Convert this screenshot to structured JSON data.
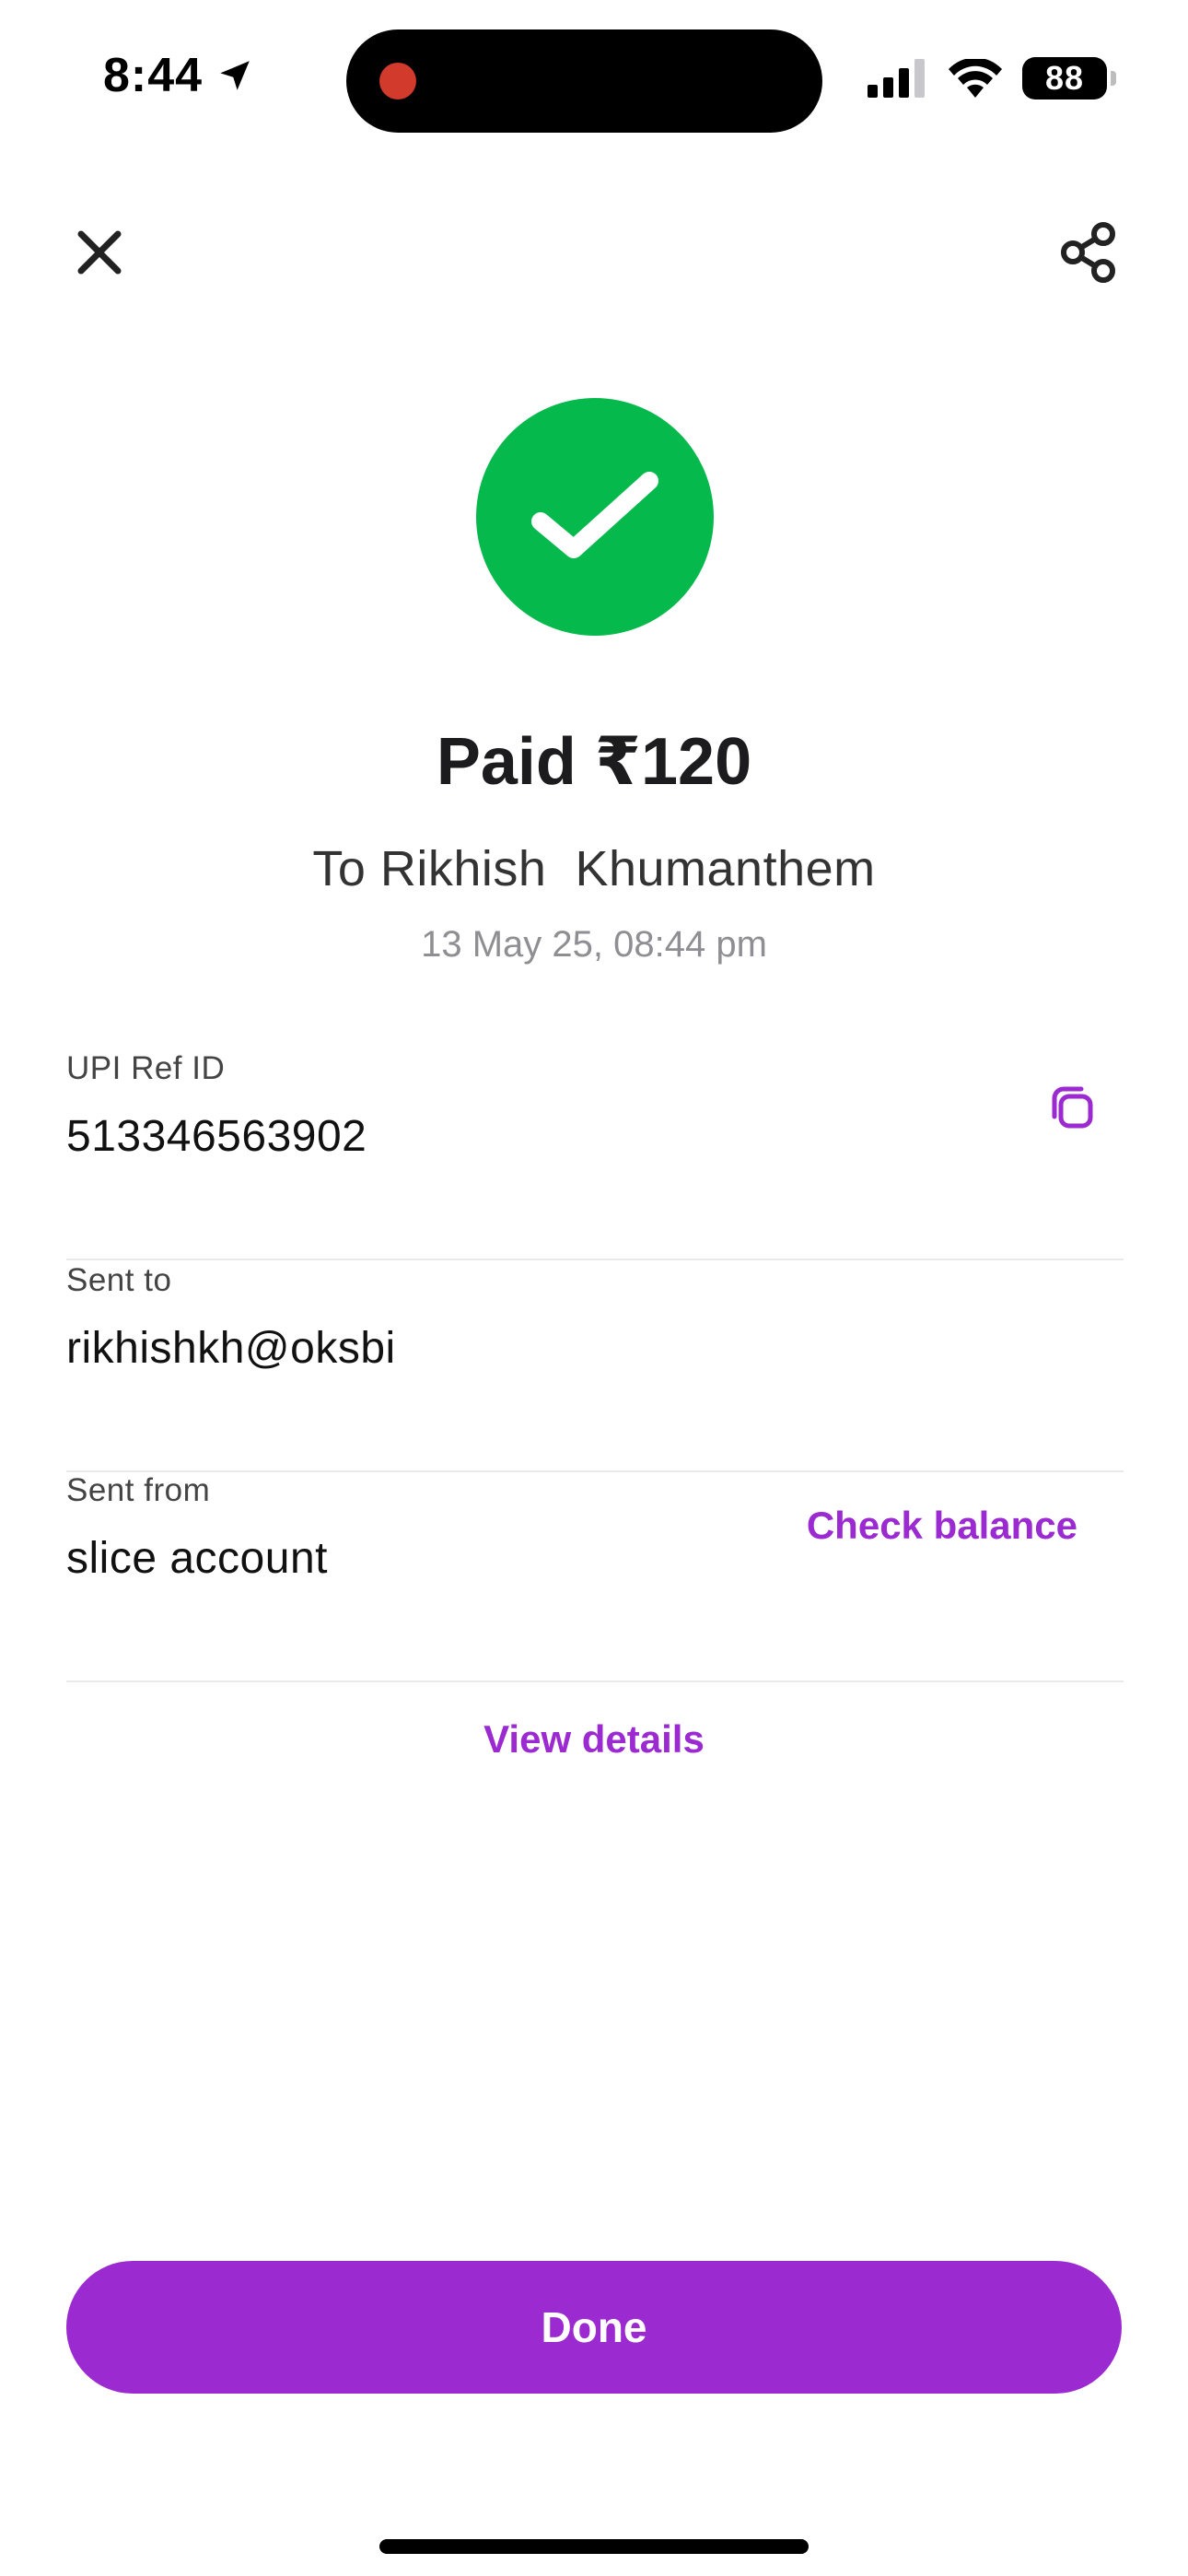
{
  "status_bar": {
    "time": "8:44",
    "battery": "88"
  },
  "payment": {
    "title": "Paid ₹120",
    "recipient": "To Rikhish  Khumanthem",
    "timestamp": "13 May 25, 08:44 pm"
  },
  "details": {
    "upi_ref": {
      "label": "UPI Ref ID",
      "value": "513346563902"
    },
    "sent_to": {
      "label": "Sent to",
      "value": "rikhishkh@oksbi"
    },
    "sent_from": {
      "label": "Sent from",
      "value": "slice account",
      "action": "Check balance"
    }
  },
  "view_details_label": "View details",
  "done_label": "Done",
  "colors": {
    "accent": "#9b2ad1",
    "success": "#05b94c"
  },
  "icons": {
    "close": "close-icon",
    "share": "share-icon",
    "success": "checkmark-icon",
    "copy": "copy-icon"
  }
}
